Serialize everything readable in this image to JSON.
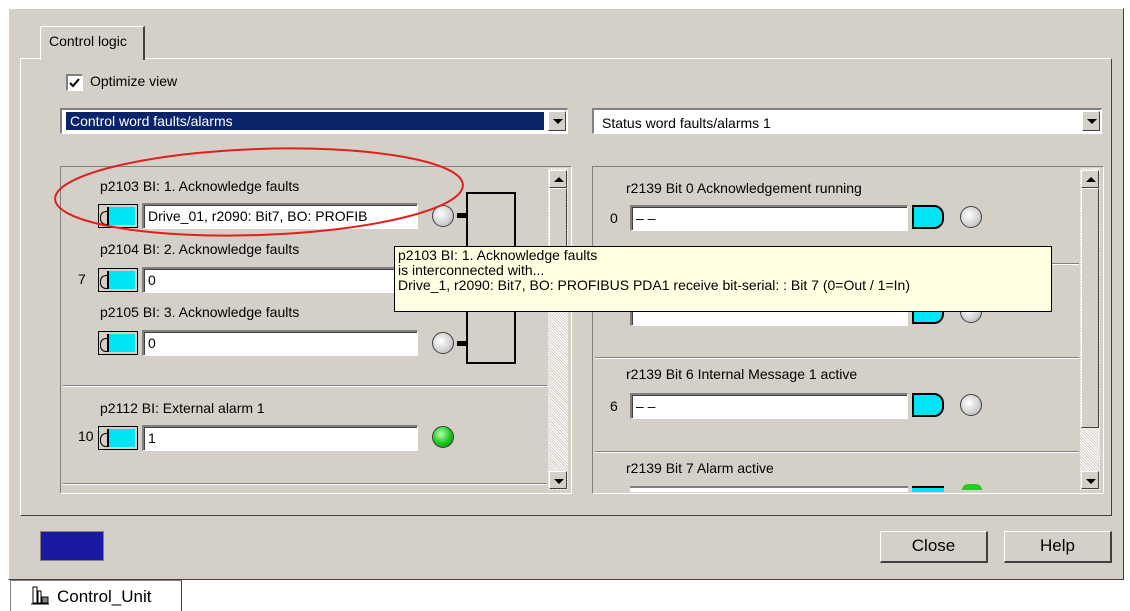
{
  "tab_label": "Control logic",
  "optimize_view": {
    "label": "Optimize view",
    "checked": true
  },
  "left_combo": {
    "value": "Control word faults/alarms"
  },
  "right_combo": {
    "value": "Status word faults/alarms 1"
  },
  "left_panel": {
    "p2103": {
      "label": "p2103 BI: 1. Acknowledge faults",
      "value": "Drive_01, r2090: Bit7, BO: PROFIB"
    },
    "p2104": {
      "label": "p2104 BI: 2. Acknowledge faults",
      "index": "7",
      "value": "0"
    },
    "p2105": {
      "label": "p2105 BI: 3. Acknowledge faults",
      "value": "0"
    },
    "p2112": {
      "label": "p2112 BI: External alarm 1",
      "index": "10",
      "value": "1"
    }
  },
  "right_panel": {
    "bit0": {
      "label": "r2139 Bit 0 Acknowledgement running",
      "index": "0",
      "value": "– –"
    },
    "bit6": {
      "label": "r2139 Bit 6 Internal Message 1 active",
      "index": "6",
      "value": "– –"
    },
    "bit7": {
      "label": "r2139 Bit 7 Alarm active"
    }
  },
  "tooltip": {
    "line1": "p2103 BI: 1. Acknowledge faults",
    "line2": "is interconnected with...",
    "line3": "Drive_1, r2090: Bit7, BO: PROFIBUS PDA1 receive bit-serial:  : Bit 7 (0=Out / 1=In)"
  },
  "buttons": {
    "close": "Close",
    "help": "Help"
  },
  "status_tab": {
    "label": "Control_Unit"
  },
  "colors": {
    "face": "#d4d0c8",
    "selection": "#0a246a",
    "connector": "#00e5f5",
    "highlight_ellipse": "#e02020",
    "tooltip_bg": "#ffffe1",
    "status_swatch": "#1a1aa0"
  }
}
